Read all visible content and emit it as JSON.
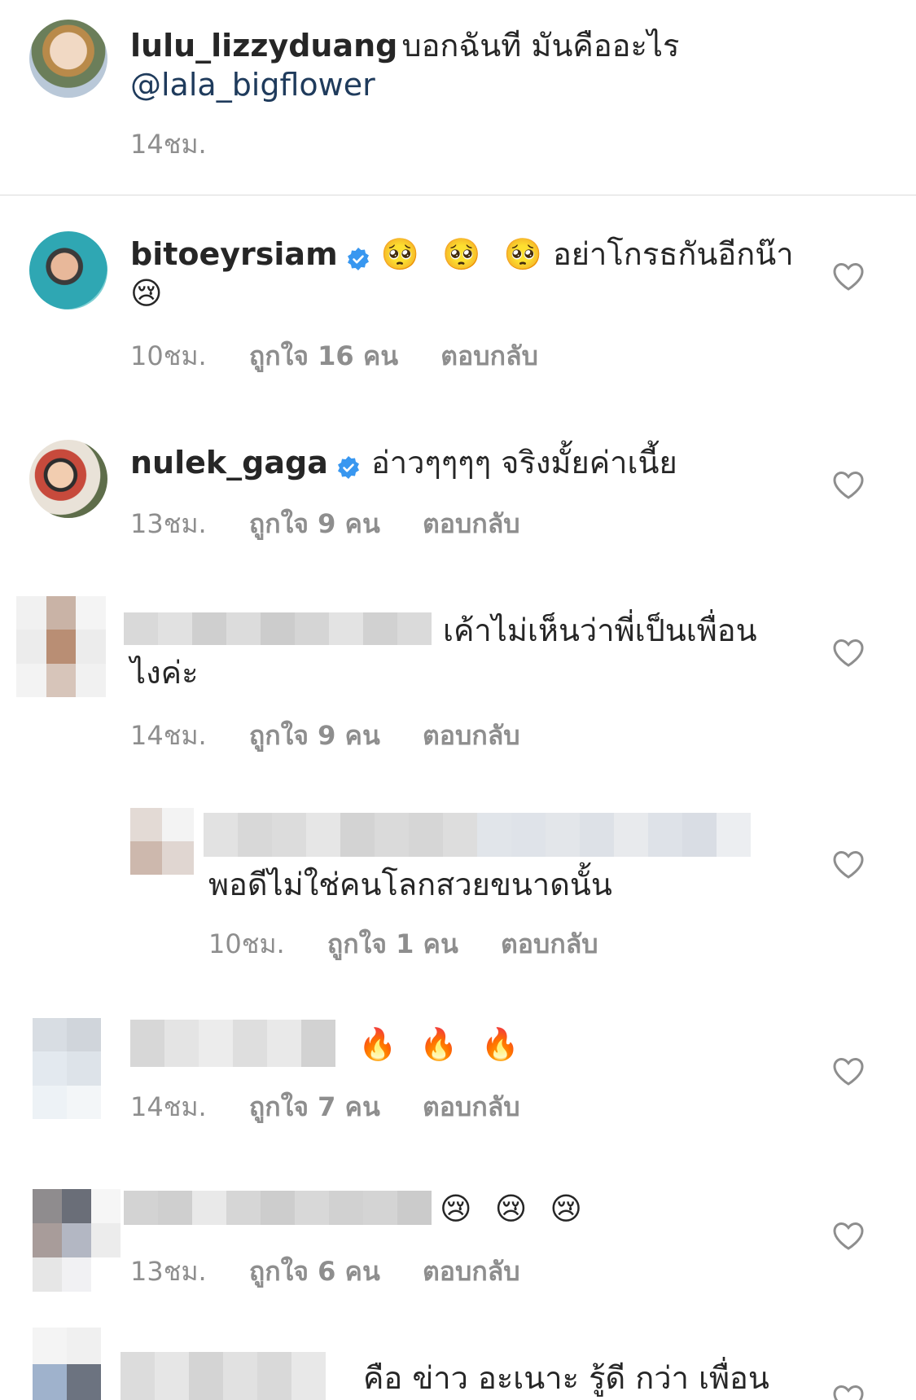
{
  "caption": {
    "username": "lulu_lizzyduang",
    "text": "บอกฉันที มันคืออะไร",
    "mention": "@lala_bigflower",
    "time": "14ชม."
  },
  "comments": [
    {
      "username": "bitoeyrsiam",
      "verified": true,
      "emoji_line1": "🥺 🥺 🥺",
      "text": "อย่าโกรธกันอีกน๊า",
      "emoji_line2": "😢",
      "time": "10ชม.",
      "likes": "ถูกใจ 16 คน",
      "reply": "ตอบกลับ"
    },
    {
      "username": "nulek_gaga",
      "verified": true,
      "text": "อ่าวๆๆๆๆ จริงมั้ยค่าเนี้ย",
      "time": "13ชม.",
      "likes": "ถูกใจ 9 คน",
      "reply": "ตอบกลับ"
    },
    {
      "username_hidden": true,
      "text_line1": "เค้าไม่เห็นว่าพี่เป็นเพื่อน",
      "text_line2": "ไงค่ะ",
      "time": "14ชม.",
      "likes": "ถูกใจ 9 คน",
      "reply": "ตอบกลับ"
    },
    {
      "reply_nested": true,
      "text": "พอดีไม่ใช่คนโลกสวยขนาดนั้น",
      "time": "10ชม.",
      "likes": "ถูกใจ 1 คน",
      "reply": "ตอบกลับ"
    },
    {
      "emoji": "🔥 🔥 🔥",
      "time": "14ชม.",
      "likes": "ถูกใจ 7 คน",
      "reply": "ตอบกลับ"
    },
    {
      "emoji": "😢 😢 😢",
      "time": "13ชม.",
      "likes": "ถูกใจ 6 คน",
      "reply": "ตอบกลับ"
    },
    {
      "text": "คือ ข่าว อะเนาะ รู้ดี กว่า เพื่อน"
    }
  ],
  "icons": {
    "heart": "heart-icon",
    "verified": "verified-badge-icon"
  },
  "colors": {
    "verified": "#3897f0",
    "secondary_text": "#8e8e8e",
    "mention": "#1f3b5c"
  }
}
